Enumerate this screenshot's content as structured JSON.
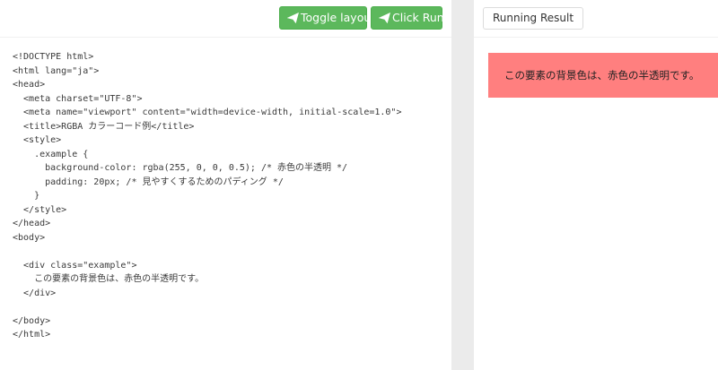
{
  "toolbar": {
    "toggle_label": "Toggle layout",
    "run_label": "Click Run",
    "toggle_icon": "send-icon",
    "run_icon": "send-icon",
    "accent_color": "#5cb85c"
  },
  "code": {
    "lines": [
      "<!DOCTYPE html>",
      "<html lang=\"ja\">",
      "<head>",
      "  <meta charset=\"UTF-8\">",
      "  <meta name=\"viewport\" content=\"width=device-width, initial-scale=1.0\">",
      "  <title>RGBA カラーコード例</title>",
      "  <style>",
      "    .example {",
      "      background-color: rgba(255, 0, 0, 0.5); /* 赤色の半透明 */",
      "      padding: 20px; /* 見やすくするためのパディング */",
      "    }",
      "  </style>",
      "</head>",
      "<body>",
      "",
      "  <div class=\"example\">",
      "    この要素の背景色は、赤色の半透明です。",
      "  </div>",
      "",
      "</body>",
      "</html>"
    ]
  },
  "result": {
    "tab_label": "Running Result",
    "example_text": "この要素の背景色は、赤色の半透明です。",
    "example_bg": "rgba(255, 0, 0, 0.5)"
  }
}
